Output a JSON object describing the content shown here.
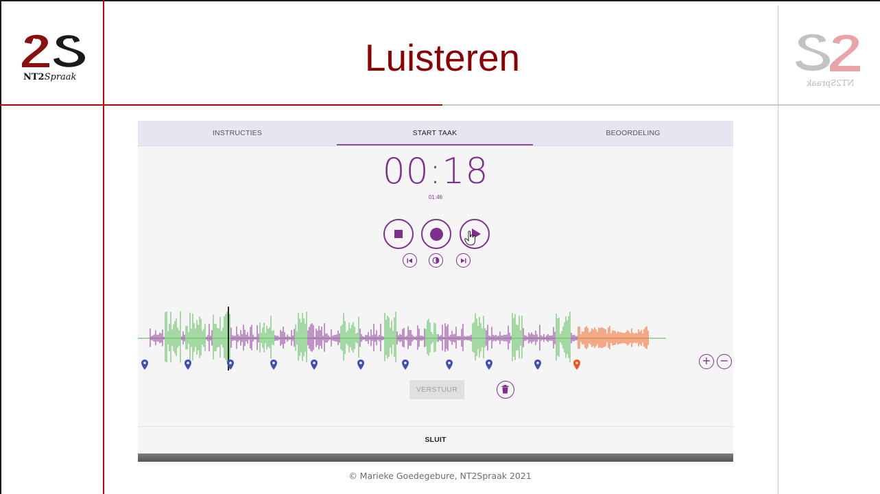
{
  "slide": {
    "title": "Luisteren",
    "footer": "© Marieke Goedegebure, NT2Spraak 2021",
    "logo_left": {
      "mark": "S2",
      "caption_bold": "NT2",
      "caption_italic": "Spraak"
    },
    "logo_right": {
      "mark": "S2",
      "caption": "NT2Spraak"
    }
  },
  "tabs": [
    {
      "label": "INSTRUCTIES",
      "active": false
    },
    {
      "label": "START TAAK",
      "active": true
    },
    {
      "label": "BEOORDELING",
      "active": false
    }
  ],
  "player": {
    "elapsed": "00:18",
    "duration": "01:46",
    "controls": [
      "stop-icon",
      "record-icon",
      "play-icon"
    ],
    "secondary_controls": [
      "skip-back-icon",
      "record-mode-icon",
      "skip-forward-icon"
    ],
    "waveform_colors": {
      "purple": "#9c4fa8",
      "green": "#6cc46a",
      "orange": "#f4743b"
    },
    "markers": [
      {
        "color": "#3f51b5"
      },
      {
        "color": "#3f51b5"
      },
      {
        "color": "#3f51b5"
      },
      {
        "color": "#3f51b5"
      },
      {
        "color": "#3f51b5"
      },
      {
        "color": "#3f51b5"
      },
      {
        "color": "#3f51b5"
      },
      {
        "color": "#3f51b5"
      },
      {
        "color": "#3f51b5"
      },
      {
        "color": "#3f51b5"
      },
      {
        "color": "#f4511e"
      }
    ],
    "zoom_in": "+",
    "zoom_out": "−"
  },
  "actions": {
    "send_label": "VERSTUUR",
    "close_label": "SLUIT"
  },
  "colors": {
    "accent": "#7c2f8c",
    "title_red": "#8b0000",
    "tab_bar": "#e6e5f1"
  }
}
